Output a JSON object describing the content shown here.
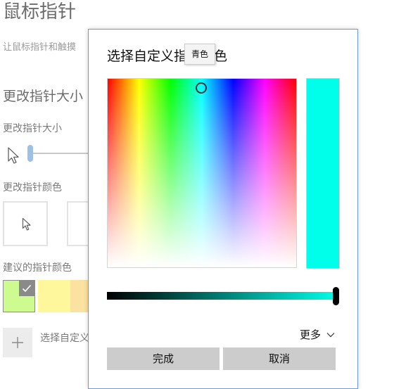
{
  "settings": {
    "title": "鼠标指针",
    "subtitle": "让鼠标指针和触摸",
    "section_title": "更改指针大小",
    "size_label": "更改指针大小",
    "color_label": "更改指针颜色",
    "suggest_label": "建议的指针颜色",
    "custom_label": "选择自定义",
    "suggested_colors": [
      "#cdfb8f",
      "#fff79b",
      "#fbe2a0"
    ]
  },
  "dialog": {
    "title": "选择自定义指针颜色",
    "tooltip": "青色",
    "selected_color": "#00ffea",
    "value_level": 1.0,
    "more_label": "更多",
    "done_label": "完成",
    "cancel_label": "取消"
  },
  "icons": {
    "pointer": "pointer-arrow-icon",
    "check": "checkmark-icon",
    "plus": "plus-icon",
    "chevron": "chevron-down-icon"
  }
}
